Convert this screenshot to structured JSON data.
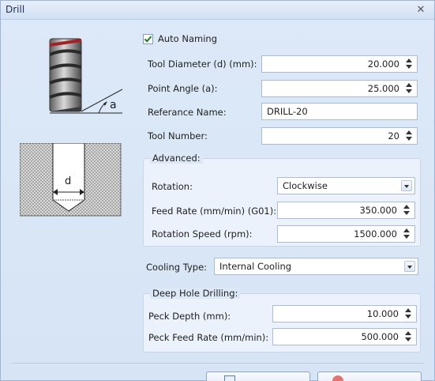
{
  "window": {
    "title": "Drill"
  },
  "auto_naming": {
    "label": "Auto Naming",
    "checked": true
  },
  "tool_diameter": {
    "label": "Tool Diameter (d) (mm):",
    "value": "20.000"
  },
  "point_angle": {
    "label": "Point Angle (a):",
    "value": "25.000"
  },
  "reference_name": {
    "label": "Referance Name:",
    "value": "DRILL-20"
  },
  "tool_number": {
    "label": "Tool Number:",
    "value": "20"
  },
  "illustration": {
    "angle_symbol": "a",
    "diameter_symbol": "d"
  },
  "advanced": {
    "title": "Advanced:",
    "rotation": {
      "label": "Rotation:",
      "value": "Clockwise"
    },
    "feed_rate": {
      "label": "Feed Rate (mm/min) (G01):",
      "value": "350.000"
    },
    "rotation_speed": {
      "label": "Rotation Speed (rpm):",
      "value": "1500.000"
    }
  },
  "cooling": {
    "label": "Cooling Type:",
    "value": "Internal Cooling"
  },
  "deep_hole": {
    "title": "Deep Hole Drilling:",
    "peck_depth": {
      "label": "Peck Depth (mm):",
      "value": "10.000"
    },
    "peck_feed_rate": {
      "label": "Peck Feed Rate (mm/min):",
      "value": "500.000"
    }
  },
  "colors": {
    "accent": "#9db4d4",
    "drill_tip": "#a61f24"
  }
}
